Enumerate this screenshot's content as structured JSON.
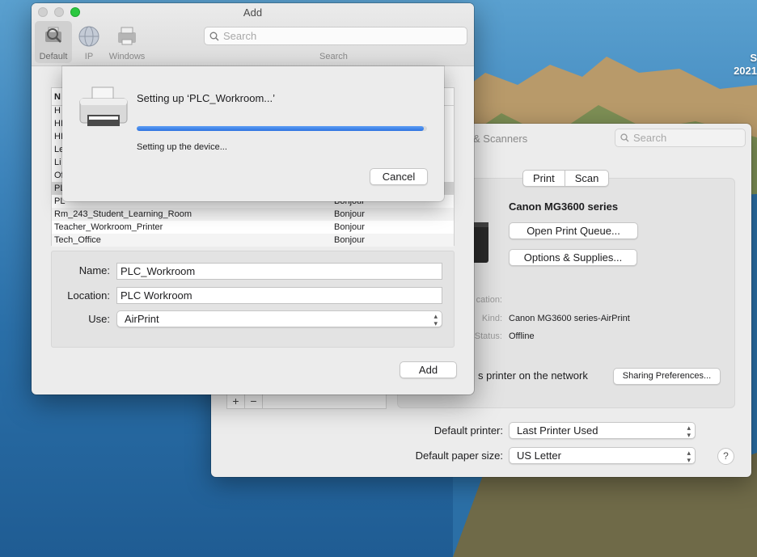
{
  "desktop": {
    "clock_line1": "S",
    "clock_line2": "2021"
  },
  "prefs_window": {
    "title": "& Scanners",
    "search_placeholder": "Search",
    "tabs": [
      "Print",
      "Scan"
    ],
    "printer_name": "Canon MG3600 series",
    "open_queue_label": "Open Print Queue...",
    "options_label": "Options & Supplies...",
    "location_label": "cation:",
    "kind_label": "Kind:",
    "kind_value": "Canon MG3600 series-AirPrint",
    "status_label": "Status:",
    "status_value": "Offline",
    "share_text": "s printer on the network",
    "sharing_prefs_label": "Sharing Preferences...",
    "add_symbol": "+",
    "remove_symbol": "−",
    "default_printer_label": "Default printer:",
    "default_printer_value": "Last Printer Used",
    "default_paper_label": "Default paper size:",
    "default_paper_value": "US Letter",
    "help_symbol": "?"
  },
  "add_window": {
    "title": "Add",
    "toolbar": [
      {
        "label": "Default",
        "icon": "default-printer-icon"
      },
      {
        "label": "IP",
        "icon": "globe-icon"
      },
      {
        "label": "Windows",
        "icon": "windows-printer-icon"
      }
    ],
    "search_placeholder": "Search",
    "search_caption": "Search",
    "list_header": "N",
    "rows": [
      {
        "name": "H",
        "kind": ""
      },
      {
        "name": "HI",
        "kind": ""
      },
      {
        "name": "HI",
        "kind": ""
      },
      {
        "name": "Le",
        "kind": ""
      },
      {
        "name": "Li",
        "kind": ""
      },
      {
        "name": "Of",
        "kind": ""
      },
      {
        "name": "PL",
        "kind": ""
      },
      {
        "name": "PL",
        "kind": "Bonjour"
      },
      {
        "name": "Rm_243_Student_Learning_Room",
        "kind": "Bonjour"
      },
      {
        "name": "Teacher_Workroom_Printer",
        "kind": "Bonjour"
      },
      {
        "name": "Tech_Office",
        "kind": "Bonjour"
      }
    ],
    "name_label": "Name:",
    "name_value": "PLC_Workroom",
    "location_label": "Location:",
    "location_value": "PLC Workroom",
    "use_label": "Use:",
    "use_value": "AirPrint",
    "add_button": "Add"
  },
  "setup_sheet": {
    "title": "Setting up ‘PLC_Workroom...’",
    "status": "Setting up the device...",
    "progress_fraction": 0.99,
    "cancel_label": "Cancel",
    "accent_color": "#2f74e0"
  }
}
